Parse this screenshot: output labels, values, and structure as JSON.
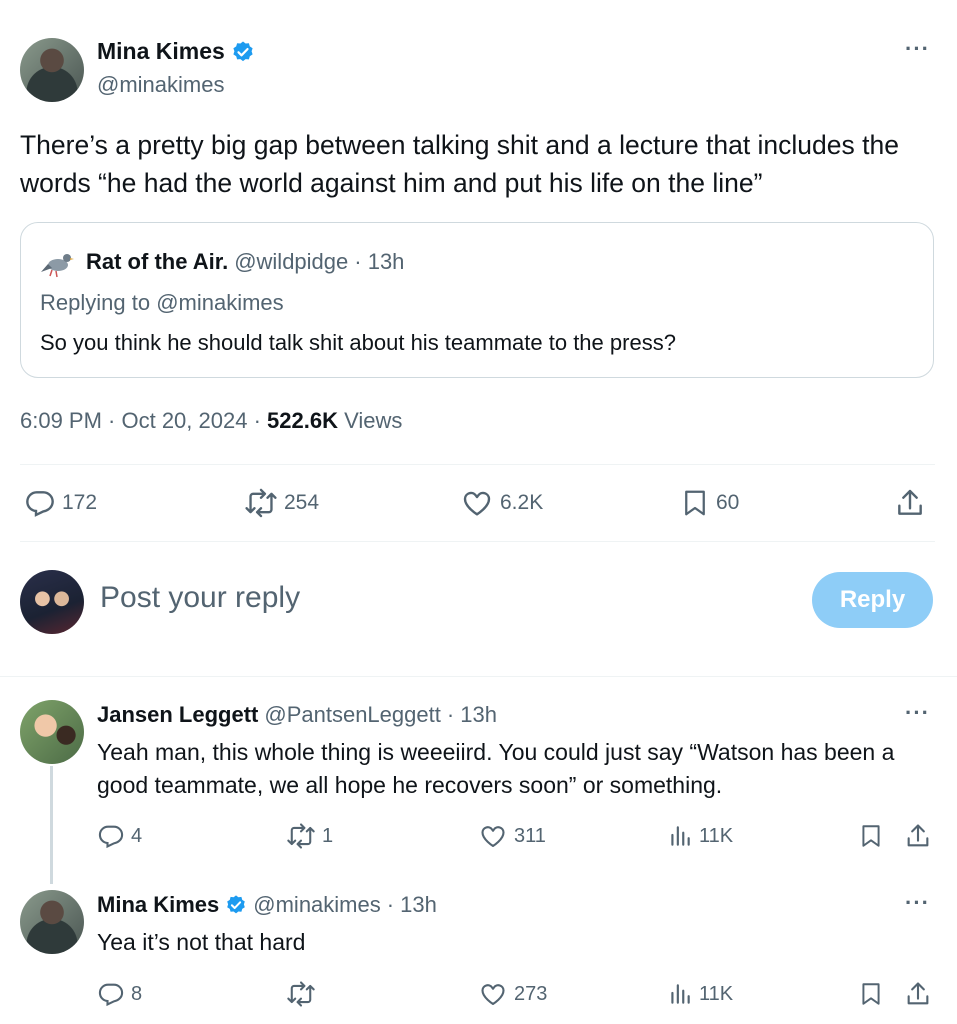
{
  "main_tweet": {
    "author_name": "Mina Kimes",
    "author_handle": "@minakimes",
    "text": "There’s a pretty big gap between talking shit and a lecture that includes the words “he had the world against him and put his life on the line”",
    "quoted": {
      "author_name": "Rat of the Air.",
      "author_handle": "@wildpidge",
      "age": "· 13h",
      "replying_to_prefix": "Replying to ",
      "replying_to_handle": "@minakimes",
      "text": "So you think he should talk shit about his teammate to the press?"
    },
    "time": "6:09 PM · Oct 20, 2024 · ",
    "views_count": "522.6K",
    "views_label": " Views",
    "stats": {
      "replies": "172",
      "reposts": "254",
      "likes": "6.2K",
      "bookmarks": "60"
    }
  },
  "composer": {
    "placeholder": "Post your reply",
    "reply_label": "Reply"
  },
  "replies": [
    {
      "author_name": "Jansen Leggett",
      "author_handle": "@PantsenLeggett",
      "age": "· 13h",
      "text": "Yeah man, this whole thing is weeeiird. You could just say “Watson has been a good teammate, we all hope he recovers soon” or something.",
      "stats": {
        "replies": "4",
        "reposts": "1",
        "likes": "311",
        "views": "11K"
      }
    },
    {
      "author_name": "Mina Kimes",
      "author_handle": "@minakimes",
      "age": "· 13h",
      "text": "Yea it’s not that hard",
      "stats": {
        "replies": "8",
        "reposts": "",
        "likes": "273",
        "views": "11K"
      }
    }
  ],
  "colors": {
    "accent": "#1d9bf0",
    "muted": "#536471",
    "reply_button": "#8ecdf7",
    "border": "#cfd9de"
  },
  "icons": [
    "verified-badge-icon",
    "more-icon",
    "reply-icon",
    "repost-icon",
    "like-icon",
    "bookmark-icon",
    "share-icon",
    "views-icon",
    "pigeon-icon"
  ]
}
